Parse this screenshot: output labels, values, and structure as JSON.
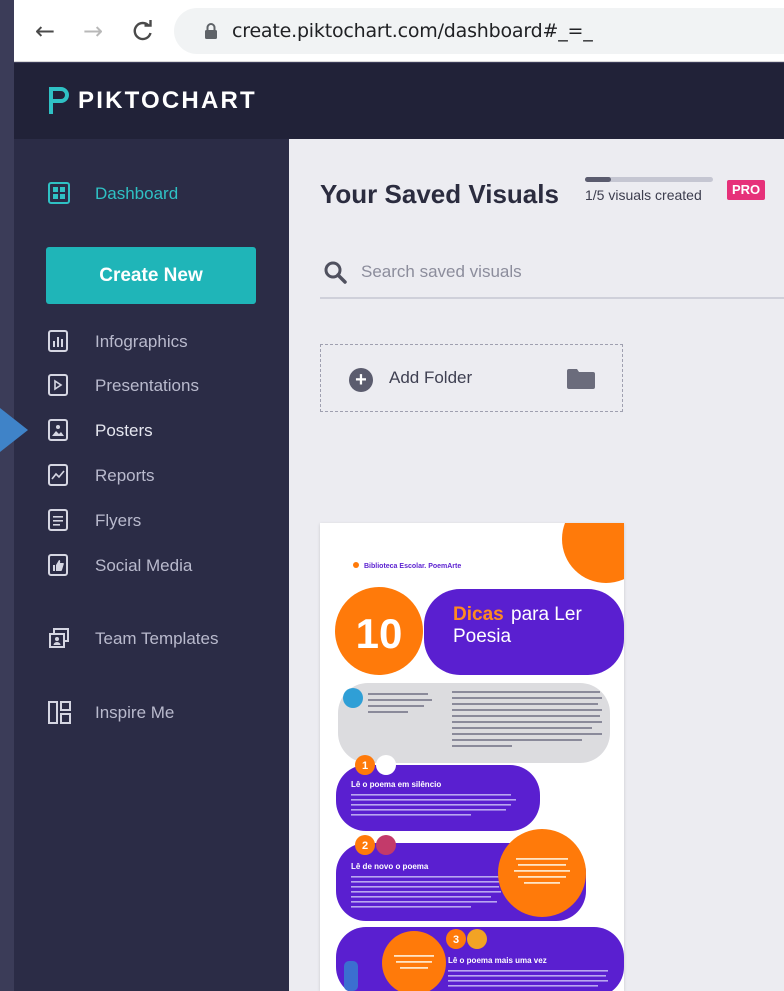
{
  "browser": {
    "back_icon": "arrow-left-icon",
    "forward_icon": "arrow-right-icon",
    "reload_icon": "reload-icon",
    "url": "create.piktochart.com/dashboard#_=_"
  },
  "header": {
    "logo_text": "PIKTOCHART"
  },
  "sidebar": {
    "dashboard": "Dashboard",
    "create_new": "Create New",
    "items": [
      {
        "label": "Infographics",
        "icon": "bar-chart-icon"
      },
      {
        "label": "Presentations",
        "icon": "presentation-icon"
      },
      {
        "label": "Posters",
        "icon": "poster-icon"
      },
      {
        "label": "Reports",
        "icon": "report-chart-icon"
      },
      {
        "label": "Flyers",
        "icon": "flyer-icon"
      },
      {
        "label": "Social Media",
        "icon": "thumbs-up-icon"
      }
    ],
    "team_templates": "Team Templates",
    "inspire_me": "Inspire Me"
  },
  "main": {
    "title": "Your Saved Visuals",
    "progress": {
      "text": "1/5 visuals created",
      "fraction": 0.2
    },
    "pro_badge": "PRO",
    "search_placeholder": "Search saved visuals",
    "add_folder": "Add Folder"
  },
  "thumbnail": {
    "brand": "Biblioteca Escolar. PoemArte",
    "number": "10",
    "title_highlight": "Dicas",
    "title_rest_1": "para Ler",
    "title_rest_2": "Poesia",
    "step1": "Lê o poema em silêncio",
    "step2": "Lê de novo o poema",
    "step3": "Lê o poema mais uma vez"
  },
  "colors": {
    "accent_teal": "#1fb5b8",
    "sidebar_bg": "#2b2c46",
    "header_bg": "#212238",
    "pro_pink": "#e6317a",
    "poster_purple": "#5a1fd0",
    "poster_orange": "#ff7a0a"
  }
}
